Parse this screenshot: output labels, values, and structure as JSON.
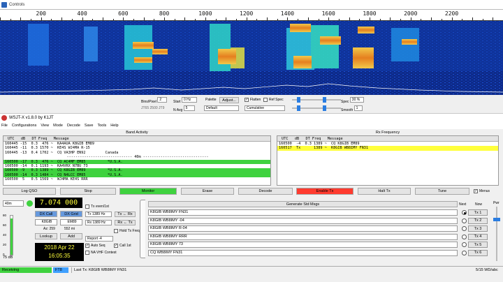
{
  "waterfall": {
    "window_title": "Controls",
    "freq_scale": [
      200,
      400,
      600,
      800,
      1000,
      1200,
      1400,
      1600,
      1800,
      2000,
      2200
    ],
    "freq_max": 2450,
    "controls": {
      "bins_label": "Bins/Pixel",
      "bins_value": "2",
      "start_label": "Start",
      "start_value": "0 Hz",
      "palette_label": "Palette",
      "adjust_label": "Adjust...",
      "flatten_label": "Flatten",
      "ref_spec_label": "Ref Spec",
      "spec_label": "Spec",
      "spec_value": "30 %",
      "readout": "JT65  2500  JT9",
      "navg_label": "N Avg",
      "navg_value": "5",
      "default_value": "Default",
      "cumulative_value": "Cumulative",
      "smooth_label": "Smooth",
      "smooth_value": "1"
    }
  },
  "app": {
    "title": "WSJT-X   v1.8.0   by K1JT",
    "menus": [
      "File",
      "Configurations",
      "View",
      "Mode",
      "Decode",
      "Save",
      "Tools",
      "Help"
    ]
  },
  "band_activity": {
    "title": "Band Activity",
    "header": " UTC   dB   DT Freq   Message",
    "rows": [
      {
        "text": "160445 -15  0.3  476 ~  KA4AUA K8GIB EM89",
        "style": ""
      },
      {
        "text": "160445 -11  0.3 1570 ~  KE4S WJ4MA R-15",
        "style": ""
      },
      {
        "text": "160445 -13  0.4 1702 ~  CQ VA3HP EN92         Canada",
        "style": ""
      },
      {
        "text": "------------------------------ 40m ------------------------------",
        "style": "sep"
      },
      {
        "text": "160500 -17  0.3  476 ~  CQ AC4MF EM85          *U.S.A.",
        "style": "g"
      },
      {
        "text": "160500 -14  0.1 1193 ~  KA4VRX N7BU 73",
        "style": ""
      },
      {
        "text": "160500 -9   0.3 1389 ~  CQ K8GIB EM89          *U.S.A.",
        "style": "g"
      },
      {
        "text": "160500 -14  0.3 1484 ~  CQ N4LCC EM85          *U.S.A.",
        "style": "g"
      },
      {
        "text": "160500  5   0.5 1569 ~  WJ4MA KE4S RRR",
        "style": ""
      }
    ]
  },
  "rx_frequency": {
    "title": "Rx Frequency",
    "header": " UTC   dB   DT Freq   Message",
    "rows": [
      {
        "text": "160500  -4  0.3 1389 ~  CQ K8GIB EM89",
        "style": ""
      },
      {
        "text": "160517  Tx      1389 ~  K8GIB WB8IMY FN31",
        "style": "y"
      }
    ]
  },
  "buttons": {
    "log_qso": "Log QSO",
    "stop": "Stop",
    "monitor": "Monitor",
    "erase": "Erase",
    "decode": "Decode",
    "enable_tx": "Enable Tx",
    "halt_tx": "Halt Tx",
    "tune": "Tune",
    "menus": "Menus"
  },
  "station": {
    "band": "40m",
    "dial_freq": "7.074 000",
    "dx_call_btn": "DX Call",
    "dx_grid_btn": "DX Grid",
    "dx_call": "K8GIB",
    "dx_grid": "EM89",
    "az": "Az: 259",
    "dist": "552 mi",
    "lookup": "Lookup",
    "add": "Add",
    "date": "2018 Apr 22",
    "time": "16:05:35",
    "level": "75 dB",
    "level_ticks": [
      "80",
      "60",
      "40",
      "20",
      "0"
    ]
  },
  "tx_settings": {
    "tx_even": "Tx even/1st",
    "tx_freq": "Tx  1389 Hz",
    "tx_to_rx": "Tx ← Rx",
    "rx_freq": "Rx  1389 Hz",
    "rx_to_tx": "Rx ← Tx",
    "hold_tx": "Hold Tx Freq",
    "report": "Report -4",
    "auto_seq": "Auto Seq",
    "call_1st": "Call 1st",
    "na_vhf": "NA VHF Contest"
  },
  "messages": {
    "generate": "Generate Std Msgs",
    "next_label": "Next",
    "now_label": "Now",
    "pwr_label": "Pwr",
    "rows": [
      {
        "text": "K8GIB WB8IMY FN31",
        "tx": "Tx 1",
        "next": true
      },
      {
        "text": "K8GIB WB8IMY -04",
        "tx": "Tx 2",
        "next": false
      },
      {
        "text": "K8GIB WB8IMY R-04",
        "tx": "Tx 3",
        "next": false
      },
      {
        "text": "K8GIB WB8IMY RRR",
        "tx": "Tx 4",
        "next": false
      },
      {
        "text": "K8GIB WB8IMY 73",
        "tx": "Tx 5",
        "next": false
      },
      {
        "text": "CQ WB8IMY FN31",
        "tx": "Tx 6",
        "next": false
      }
    ]
  },
  "status": {
    "state": "Receiving",
    "mode": "FT8",
    "last_tx": "Last Tx: K8GIB WB8IMY FN31",
    "right": "5/15    WD/abc"
  },
  "colors": {
    "monitor": "#3fd23f",
    "enable_tx": "#ff3b2f",
    "dial_bg": "#000000",
    "receiving": "#3fd23f",
    "mode_bg": "#3fa0ff"
  }
}
